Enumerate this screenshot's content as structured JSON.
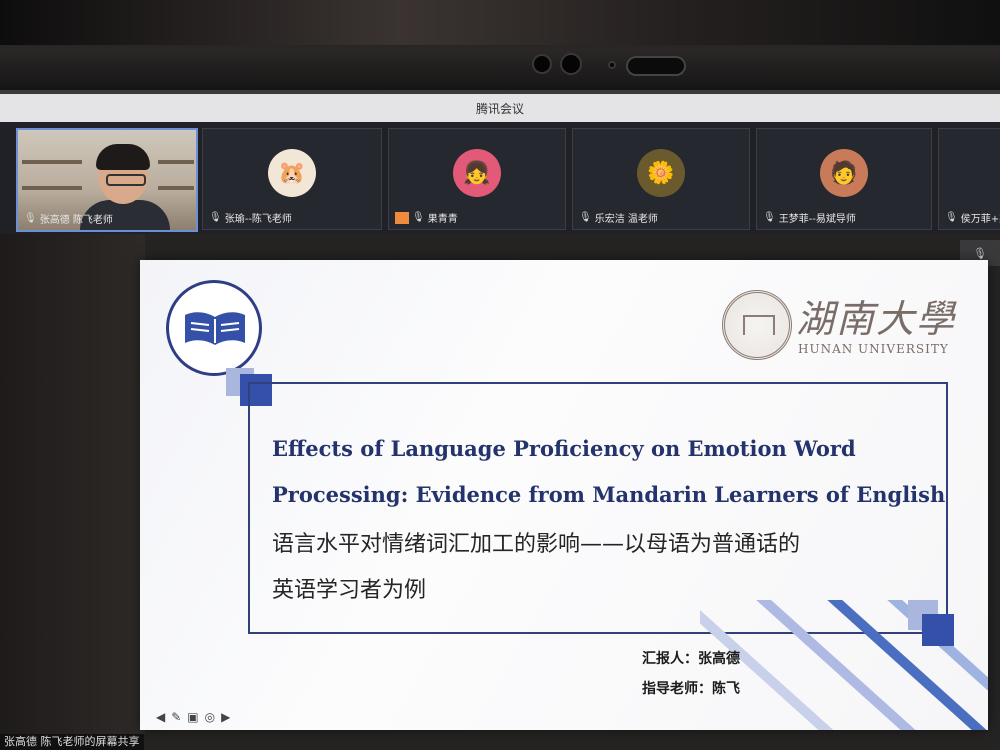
{
  "window": {
    "title": "腾讯会议"
  },
  "participants": [
    {
      "name": "张高德 陈飞老师",
      "type": "camera",
      "active": true
    },
    {
      "name": "张瑜--陈飞老师",
      "type": "avatar",
      "avatar_icon": "hamster-icon",
      "avatar_color": "#f2e6d6"
    },
    {
      "name": "果青青",
      "type": "avatar",
      "avatar_icon": "girl-photo-icon",
      "avatar_color": "#e25a78"
    },
    {
      "name": "乐宏洁 温老师",
      "type": "avatar",
      "avatar_icon": "flower-photo-icon",
      "avatar_color": "#6b5a2e"
    },
    {
      "name": "王梦菲--易斌导师",
      "type": "avatar",
      "avatar_icon": "cartoon-photo-icon",
      "avatar_color": "#c97a58"
    },
    {
      "name": "侯万菲+梁",
      "type": "avatar",
      "avatar_icon": "user-icon",
      "avatar_color": "#555"
    }
  ],
  "slide": {
    "title_en_line1": "Effects of Language Proficiency on Emotion Word",
    "title_en_line2": "Processing: Evidence from Mandarin Learners of English",
    "title_zh_line1": "语言水平对情绪词汇加工的影响——以母语为普通话的",
    "title_zh_line2": "英语学习者为例",
    "university_zh": "湖南大學",
    "university_en": "HUNAN UNIVERSITY",
    "reporter": "汇报人：张高德",
    "advisor": "指导老师：陈飞",
    "accent_color": "#3550a8"
  },
  "share_label": "张高德 陈飞老师的屏幕共享"
}
